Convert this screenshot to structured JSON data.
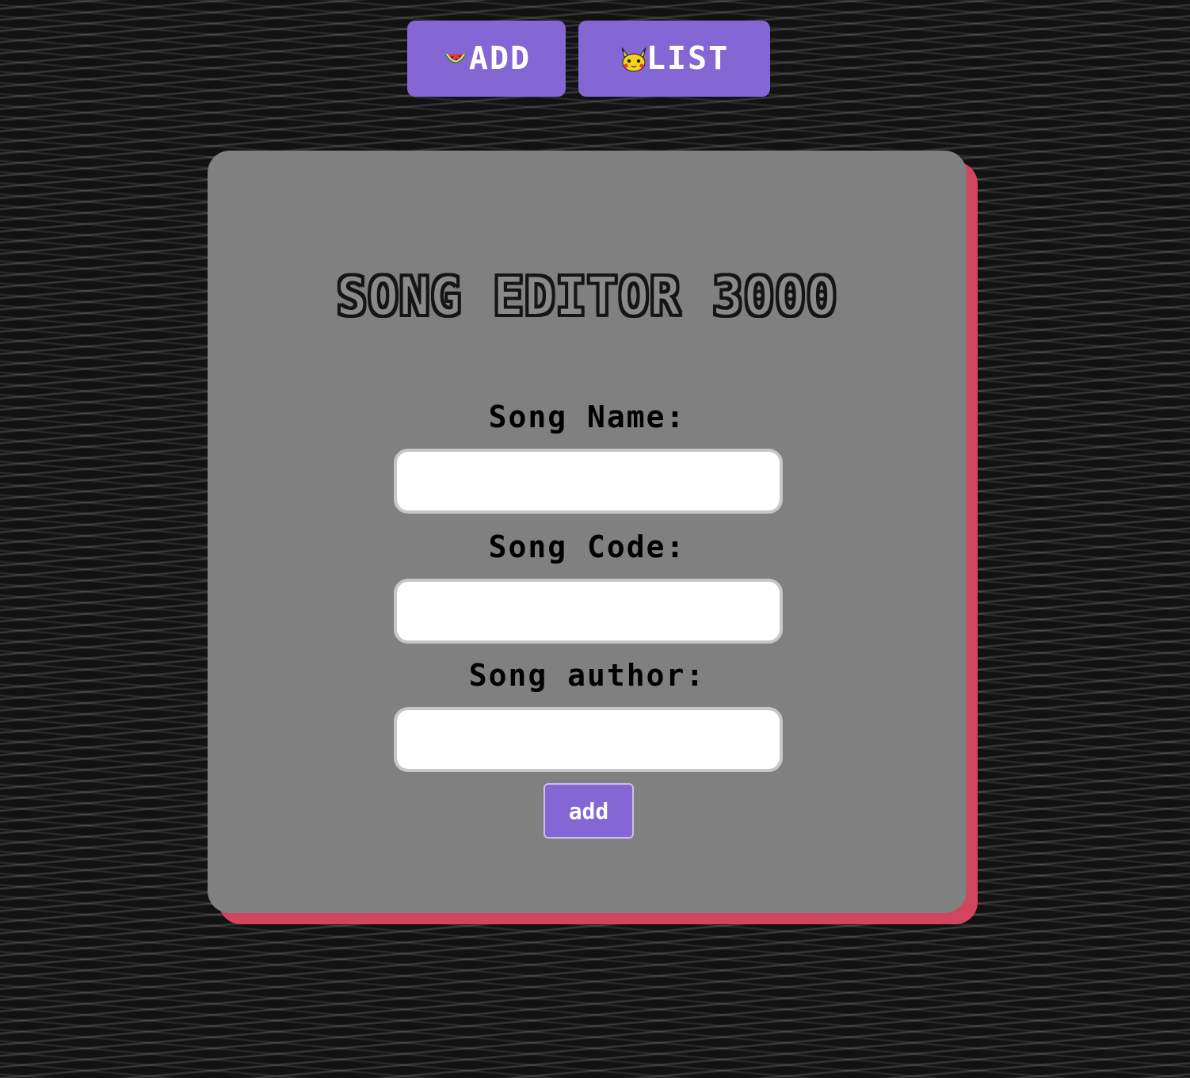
{
  "nav": {
    "add_label": "ADD",
    "add_icon": "watermelon-icon",
    "list_label": "LIST",
    "list_icon": "pikachu-icon",
    "button_color": "#8466d4"
  },
  "form": {
    "title": "SONG EDITOR 3000",
    "song_name_label": "Song Name:",
    "song_name_value": "",
    "song_code_label": "Song Code:",
    "song_code_value": "",
    "song_author_label": "Song author:",
    "song_author_value": "",
    "submit_label": "add"
  },
  "colors": {
    "background": "#121212",
    "card": "#808080",
    "card_shadow": "#d2455e",
    "accent": "#8466d4"
  }
}
